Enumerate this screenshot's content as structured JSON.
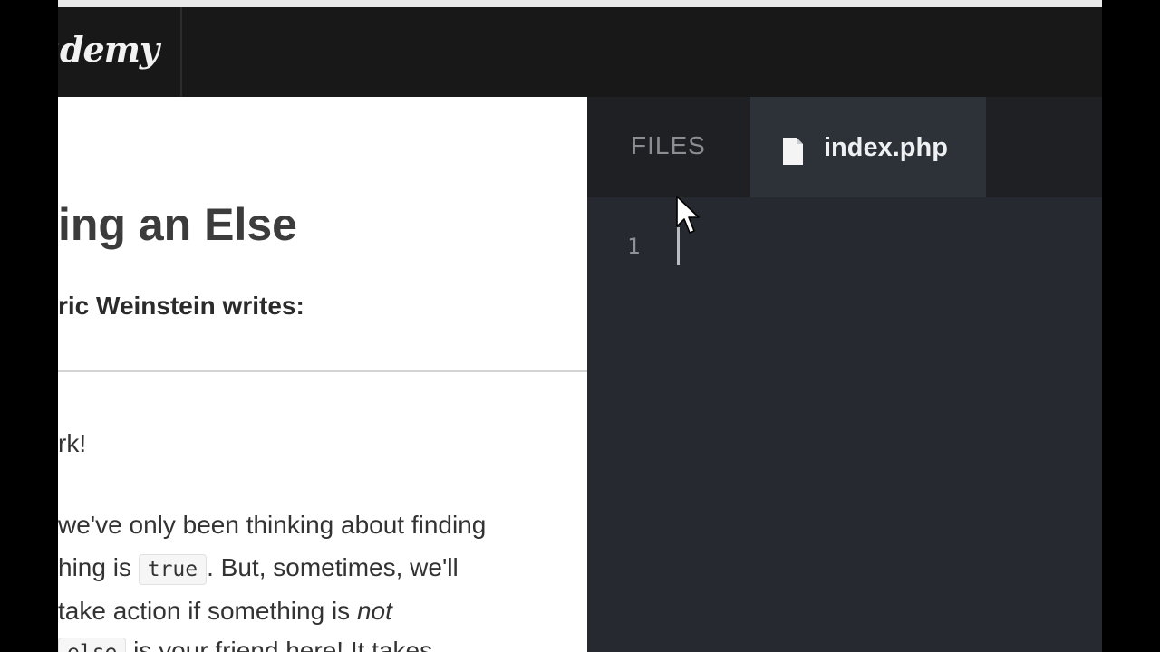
{
  "header": {
    "logo_text": "ademy"
  },
  "lesson": {
    "title": "ing an Else",
    "author": "ric Weinstein writes:",
    "paragraph1": "rk!",
    "paragraph2": {
      "line1": "we've only been thinking about finding",
      "line2_before": "hing is ",
      "line2_code": "true",
      "line2_after": ". But, sometimes, we'll",
      "line3_before": "take action if something is ",
      "line3_em": "not",
      "line4_code": "else",
      "line4_after": " is your friend here! It takes"
    }
  },
  "editor": {
    "files_tab_label": "FILES",
    "active_file": "index.php",
    "line_numbers": [
      "1"
    ],
    "icons": {
      "file": "file-icon",
      "pointer": "mouse-pointer-icon"
    },
    "colors": {
      "header_bg": "#181818",
      "editor_bg": "#262a30",
      "active_tab_bg": "#2d3238"
    }
  }
}
